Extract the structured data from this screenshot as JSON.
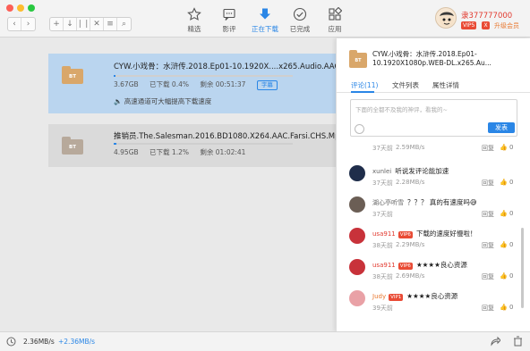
{
  "toolbar": {
    "nav": [
      {
        "label": "精选",
        "icon": "star-icon"
      },
      {
        "label": "影评",
        "icon": "comment-icon"
      },
      {
        "label": "正在下载",
        "icon": "download-icon"
      },
      {
        "label": "已完成",
        "icon": "check-icon"
      },
      {
        "label": "应用",
        "icon": "apps-icon"
      }
    ],
    "active_index": 2,
    "user": {
      "name": "隶377777000",
      "vip_badge": "VIP5",
      "vip_close": "X",
      "upgrade": "升级会员"
    }
  },
  "tasks": [
    {
      "name": "CYW.小戏骨：水浒传.2018.Ep01-10.1920X....x265.Audio.AAC-无水印",
      "size": "3.67GB",
      "downloaded": "已下载 0.4%",
      "remaining": "剩余 00:51:37",
      "badge": "字幕",
      "progress": 0.004,
      "accel_text": "高速通道可大幅提高下载速度",
      "folder_label": "BT"
    },
    {
      "name": "推销员.The.Salesman.2016.BD1080.X264.AAC.Farsi.CHS.Mp45678",
      "size": "4.95GB",
      "downloaded": "已下载 1.2%",
      "remaining": "剩余 01:02:41",
      "progress": 0.012,
      "folder_label": "BT"
    }
  ],
  "bottom": {
    "speed": "2.36MB/s",
    "speed_extra": "+2.36MB/s"
  },
  "panel": {
    "title": "CYW.小戏骨：水浒传.2018.Ep01-10.1920X1080p.WEB-DL.x265.Au...",
    "folder_label": "BT",
    "tabs": [
      "评论(11)",
      "文件列表",
      "属性详情"
    ],
    "comment_placeholder": "下面的全都不及我的神评，看我的~",
    "send_label": "发表",
    "comments": [
      {
        "user": "",
        "text": "",
        "time": "37天前",
        "speed": "2.59MB/s",
        "reply": "回复",
        "likes": "0",
        "vip": ""
      },
      {
        "user": "xunlei",
        "text": "听说发评论能加速",
        "time": "37天前",
        "speed": "2.28MB/s",
        "reply": "回复",
        "likes": "0",
        "vip": ""
      },
      {
        "user": "湖心亭听雪",
        "text": "？？？ 真的有速度吗😅",
        "time": "37天前",
        "speed": "",
        "reply": "回复",
        "likes": "0",
        "vip": ""
      },
      {
        "user": "usa911",
        "text": "下载的速度好慢啦！",
        "time": "38天前",
        "speed": "2.29MB/s",
        "reply": "回复",
        "likes": "0",
        "vip": "VIP6"
      },
      {
        "user": "usa911",
        "text": "★★★★良心资源",
        "time": "38天前",
        "speed": "2.69MB/s",
        "reply": "回复",
        "likes": "0",
        "vip": "VIP6"
      },
      {
        "user": "Judy",
        "text": "★★★★良心资源",
        "time": "39天前",
        "speed": "",
        "reply": "回复",
        "likes": "0",
        "vip": "VIP1"
      }
    ]
  }
}
